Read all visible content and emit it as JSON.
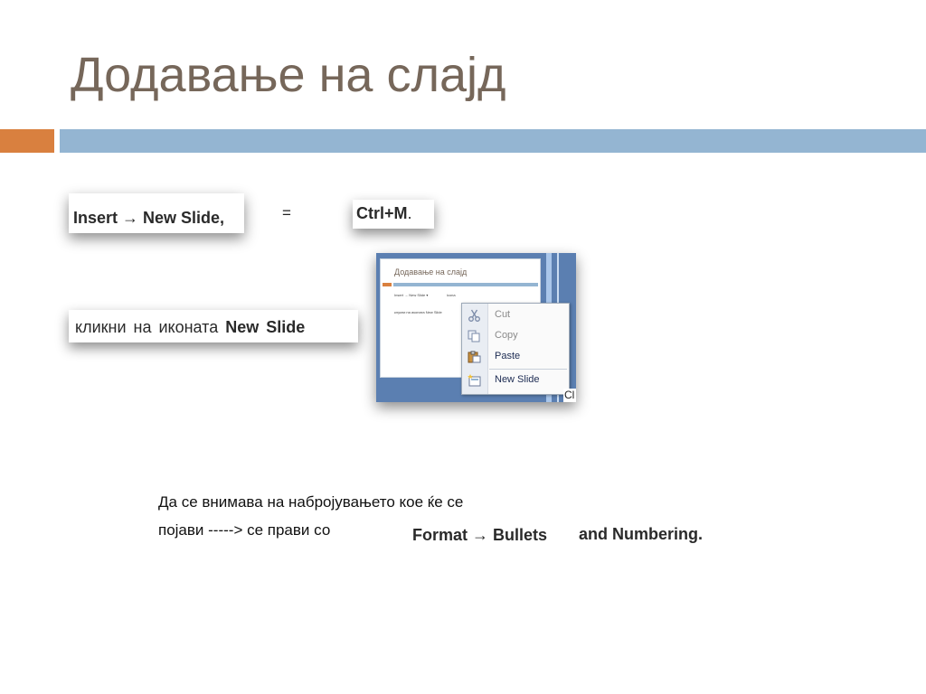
{
  "slide": {
    "title": "Додавање на слајд",
    "insert_snip": "Insert → New Slide,",
    "equals": "=",
    "ctrl_m": "Ctrl+M",
    "ctrl_m_dot": ".",
    "click_text": "кликни на иконата ",
    "click_bold": "New Slide",
    "note_line1": "Да се внимава на набројувањето кое ќе се",
    "note_line2": "појави  -----> се прави со",
    "format_snip": "Format → Bullets",
    "format_snip_2": "and Numbering.",
    "colors": {
      "title": "#76675a",
      "accent_orange": "#d9803f",
      "accent_blue": "#94b5d2"
    }
  },
  "thumbnail": {
    "title": "Додавање на слајд",
    "line1": "Insert → New Slide   ▾",
    "line1b": "icona",
    "line2": "клукни на иконата New Slide",
    "corner_text": "Cl",
    "context_menu": [
      {
        "label": "Cut",
        "icon": "scissors-icon",
        "enabled": false
      },
      {
        "label": "Copy",
        "icon": "copy-icon",
        "enabled": false
      },
      {
        "label": "Paste",
        "icon": "paste-icon",
        "enabled": true
      },
      {
        "label": "New Slide",
        "icon": "new-slide-icon",
        "enabled": true
      }
    ]
  }
}
